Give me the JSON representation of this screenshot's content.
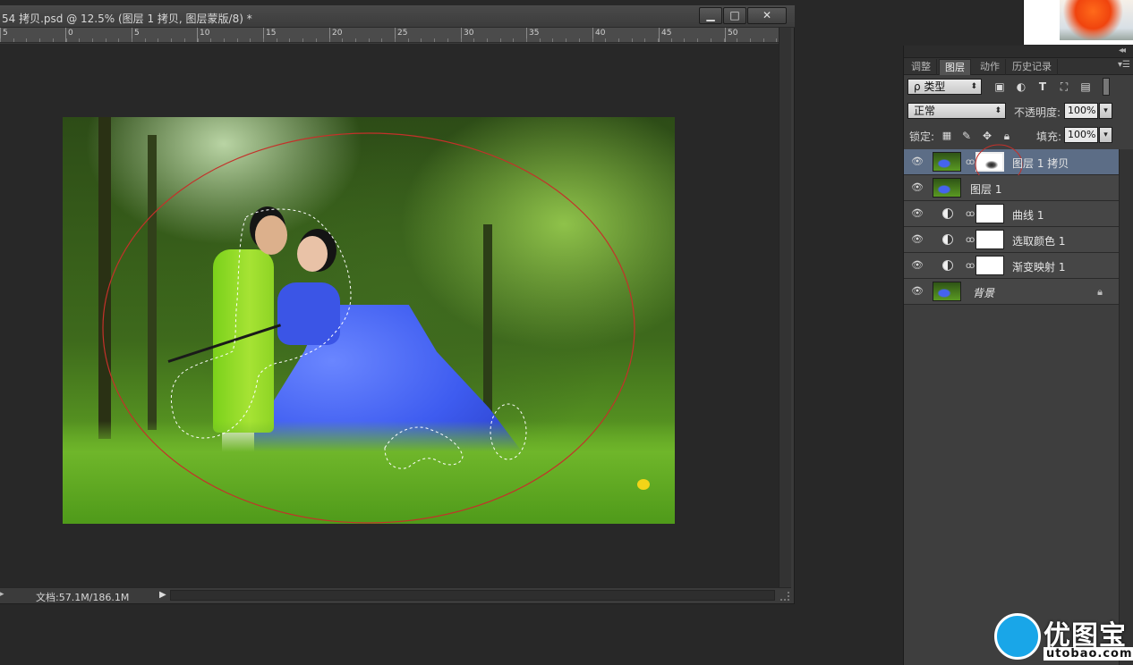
{
  "window": {
    "title": "54 拷贝.psd @ 12.5% (图层 1 拷贝, 图层蒙版/8) *",
    "buttons": {
      "minimize": "▁",
      "maximize": "□",
      "close": "✕"
    }
  },
  "ruler": {
    "labels": [
      "5",
      "0",
      "5",
      "10",
      "15",
      "20",
      "25",
      "30",
      "35",
      "40",
      "45",
      "50"
    ]
  },
  "status": {
    "doc_size": "文档:57.1M/186.1M",
    "menu_arrow": "▶",
    "left_arrow": "▸"
  },
  "panel": {
    "tabs": [
      "调整",
      "图层",
      "动作",
      "历史记录"
    ],
    "active_tab": "图层",
    "filter": {
      "label": "ρ 类型"
    },
    "filter_icons": [
      "image-filter-icon",
      "adjustment-filter-icon",
      "type-filter-icon",
      "shape-filter-icon",
      "smart-object-filter-icon"
    ],
    "blend_mode": "正常",
    "opacity_label": "不透明度:",
    "opacity_value": "100%",
    "lock_label": "锁定:",
    "fill_label": "填充:",
    "fill_value": "100%",
    "lock_icons": [
      "lock-transparent-icon",
      "lock-paint-icon",
      "lock-move-icon",
      "lock-all-icon"
    ]
  },
  "layers": [
    {
      "name": "图层 1 拷贝",
      "kind": "pixel-with-mask",
      "selected": true
    },
    {
      "name": "图层 1",
      "kind": "pixel",
      "selected": false
    },
    {
      "name": "曲线 1",
      "kind": "adjustment",
      "selected": false
    },
    {
      "name": "选取颜色 1",
      "kind": "adjustment",
      "selected": false
    },
    {
      "name": "渐变映射 1",
      "kind": "adjustment",
      "selected": false
    },
    {
      "name": "背景",
      "kind": "background",
      "selected": false,
      "locked": true
    }
  ],
  "watermark": {
    "text": "优图宝",
    "url": "utobao.com"
  },
  "colors": {
    "selected_layer": "#5c6d86",
    "ellipse_stroke": "#c4312a",
    "panel_bg": "#3e3e3e"
  }
}
